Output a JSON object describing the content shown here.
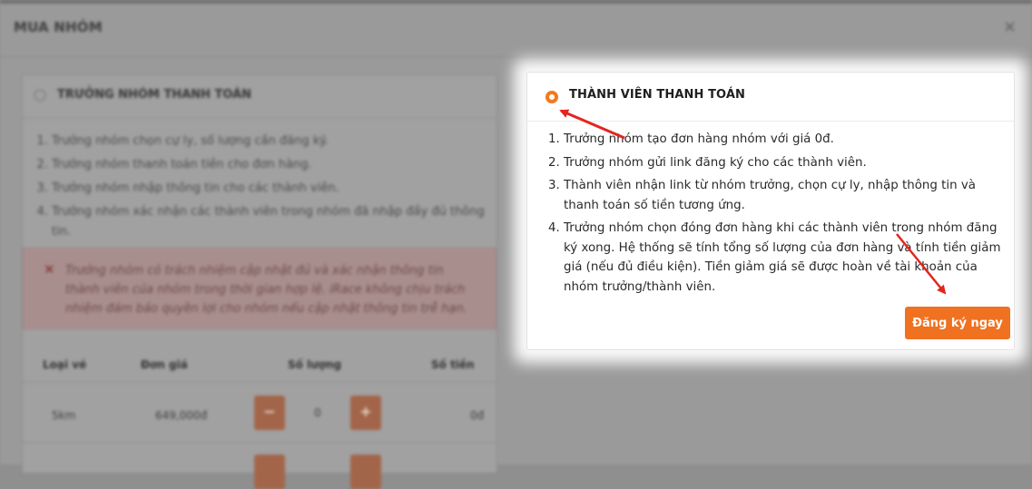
{
  "modal": {
    "title": "MUA NHÓM",
    "close_label": "×"
  },
  "leader_option": {
    "title": "TRƯỞNG NHÓM THANH TOÁN",
    "steps": [
      "Trưởng nhóm chọn cự ly, số lượng cần đăng ký.",
      "Trưởng nhóm thanh toán tiền cho đơn hàng.",
      "Trưởng nhóm nhập thông tin cho các thành viên.",
      "Trưởng nhóm xác nhận các thành viên trong nhóm đã nhập đầy đủ thông tin."
    ],
    "alert_icon": "close-x-icon",
    "alert_text": "Trưởng nhóm có trách nhiệm cập nhật đủ và xác nhận thông tin thành viên của nhóm trong thời gian hợp lệ. iRace không chịu trách nhiệm đảm bảo quyền lợi cho nhóm nếu cập nhật thông tin trễ hạn.",
    "table": {
      "headers": [
        "Loại vé",
        "Đơn giá",
        "Số lượng",
        "Số tiền"
      ],
      "rows": [
        {
          "type": "5km",
          "price": "649,000đ",
          "qty": "0",
          "amount": "0đ"
        }
      ],
      "minus_label": "−",
      "plus_label": "+"
    }
  },
  "member_option": {
    "title": "THÀNH VIÊN THANH TOÁN",
    "steps": [
      "Trưởng nhóm tạo đơn hàng nhóm với giá 0đ.",
      "Trưởng nhóm gửi link đăng ký cho các thành viên.",
      "Thành viên nhận link từ nhóm trưởng, chọn cự ly, nhập thông tin và thanh toán số tiền tương ứng.",
      "Trưởng nhóm chọn đóng đơn hàng khi các thành viên trong nhóm đăng ký xong. Hệ thống sẽ tính tổng số lượng của đơn hàng và tính tiền giảm giá (nếu đủ điều kiện). Tiền giảm giá sẽ được hoàn về tài khoản của nhóm trưởng/thành viên."
    ],
    "register_button": "Đăng ký ngay"
  },
  "colors": {
    "accent": "#f0711f",
    "annotation_arrow": "#e3261f"
  }
}
